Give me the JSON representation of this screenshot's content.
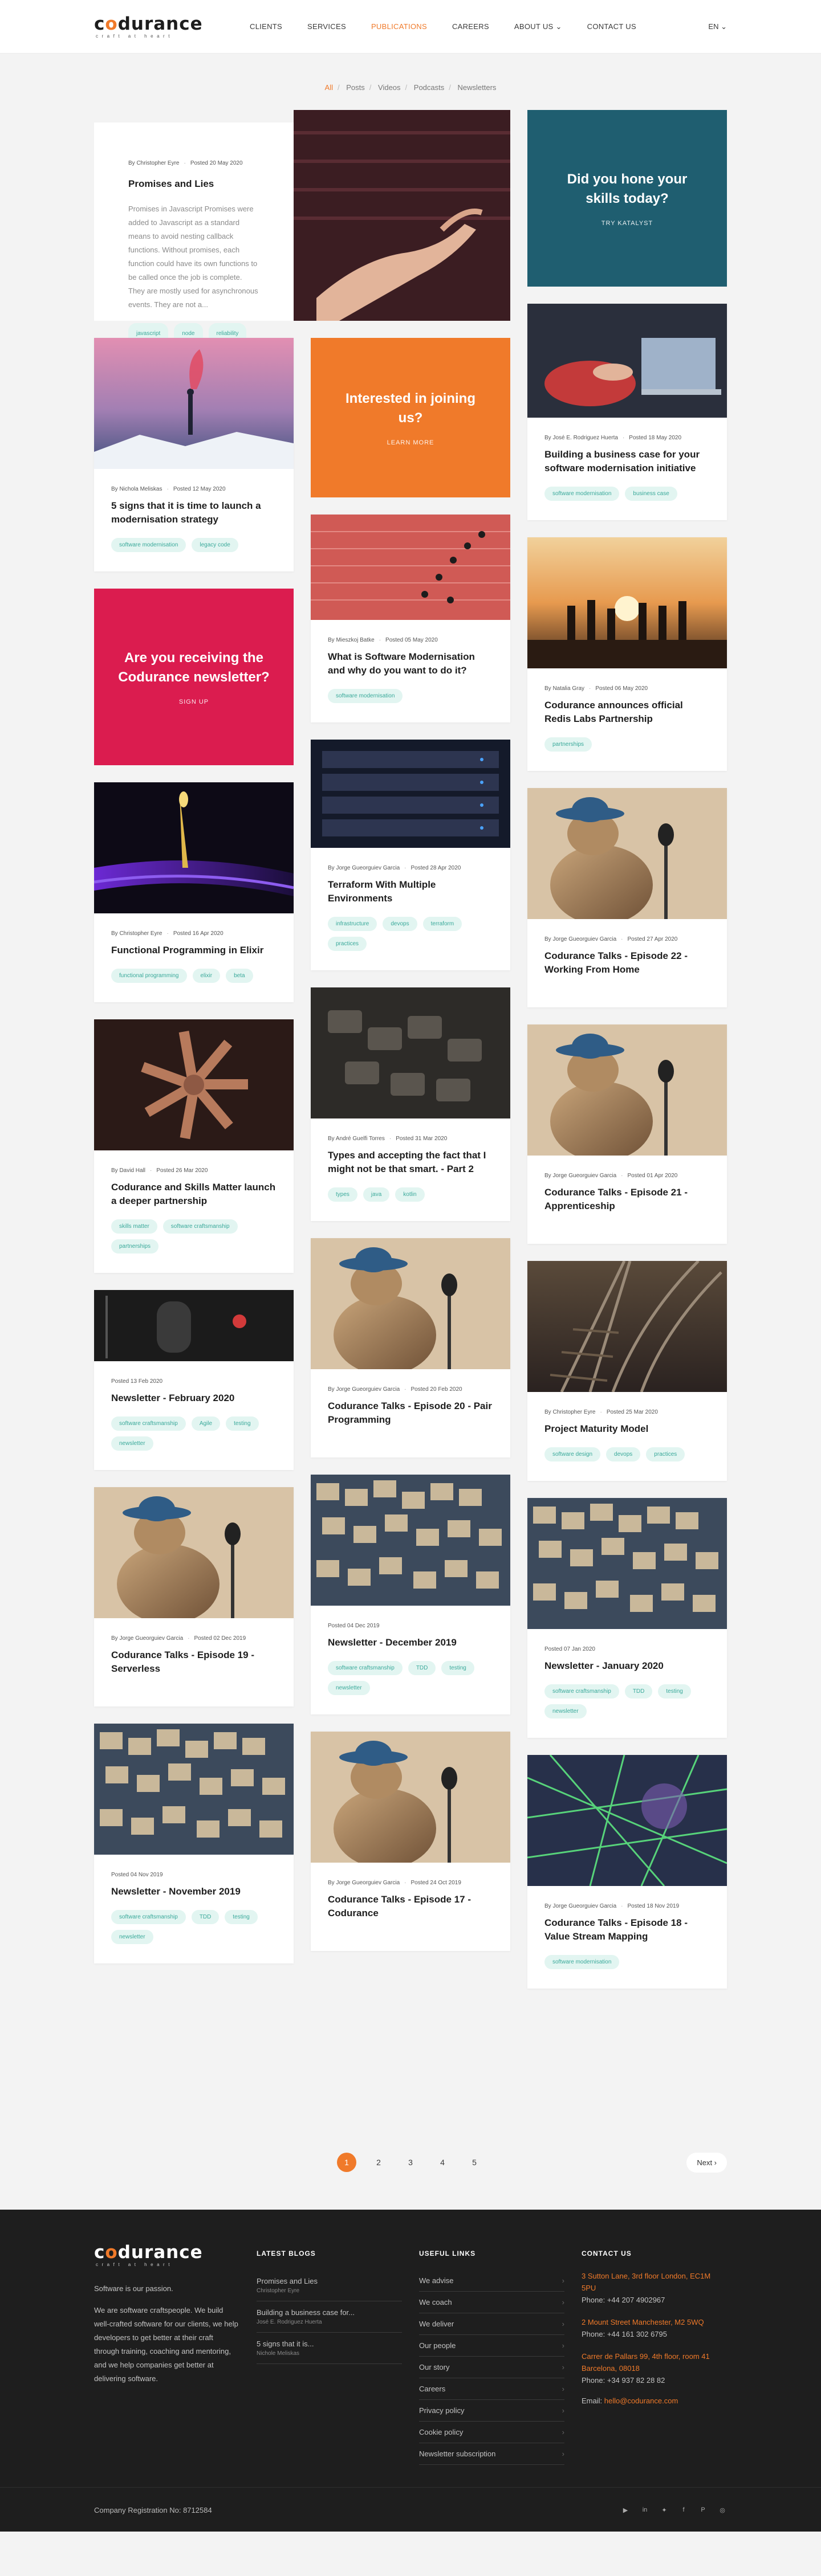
{
  "header": {
    "logo_main": "codurance",
    "logo_tag": "craft at heart",
    "nav": [
      "CLIENTS",
      "SERVICES",
      "PUBLICATIONS",
      "CAREERS",
      "ABOUT US",
      "CONTACT US"
    ],
    "nav_active": "PUBLICATIONS",
    "about_chevron": "⌄",
    "lang": "EN ⌄"
  },
  "filters": [
    "All",
    "Posts",
    "Videos",
    "Podcasts",
    "Newsletters"
  ],
  "filter_active": "All",
  "feature": {
    "author": "By Christopher Eyre",
    "date": "Posted 20 May 2020",
    "title": "Promises and Lies",
    "excerpt": "Promises in Javascript Promises were added to Javascript as a standard means to avoid nesting callback functions. Without promises, each function could have its own functions to be called once the job is complete. They are mostly used for asynchronous events. They are not a...",
    "tags": [
      "javascript",
      "node",
      "reliability"
    ]
  },
  "promos": {
    "teal": {
      "title": "Did you hone your skills today?",
      "link": "TRY KATALYST"
    },
    "orange": {
      "title": "Interested in joining us?",
      "link": "LEARN MORE"
    },
    "pink": {
      "title": "Are you receiving the Codurance newsletter?",
      "link": "SIGN UP"
    }
  },
  "cards": {
    "c1": {
      "author": "By Nichola Meliskas",
      "date": "Posted 12 May 2020",
      "title": "5 signs that it is time to launch a modernisation strategy",
      "tags": [
        "software modernisation",
        "legacy code"
      ]
    },
    "c2": {
      "author": "By Christopher Eyre",
      "date": "Posted 16 Apr 2020",
      "title": "Functional Programming in Elixir",
      "tags": [
        "functional programming",
        "elixir",
        "beta"
      ]
    },
    "c3": {
      "author": "By David Hall",
      "date": "Posted 26 Mar 2020",
      "title": "Codurance and Skills Matter launch a deeper partnership",
      "tags": [
        "skills matter",
        "software craftsmanship",
        "partnerships"
      ]
    },
    "c4": {
      "author": "",
      "date": "Posted 13 Feb 2020",
      "title": "Newsletter - February 2020",
      "tags": [
        "software craftsmanship",
        "Agile",
        "testing",
        "newsletter"
      ]
    },
    "c5": {
      "author": "By Jorge Gueorguiev Garcia",
      "date": "Posted 02 Dec 2019",
      "title": "Codurance Talks - Episode 19 - Serverless",
      "tags": []
    },
    "c6": {
      "author": "",
      "date": "Posted 04 Nov 2019",
      "title": "Newsletter - November 2019",
      "tags": [
        "software craftsmanship",
        "TDD",
        "testing",
        "newsletter"
      ]
    },
    "c7": {
      "author": "By Mieszkoj Batke",
      "date": "Posted 05 May 2020",
      "title": "What is Software Modernisation and why do you want to do it?",
      "tags": [
        "software modernisation"
      ]
    },
    "c8": {
      "author": "By Jorge Gueorguiev Garcia",
      "date": "Posted 28 Apr 2020",
      "title": "Terraform With Multiple Environments",
      "tags": [
        "infrastructure",
        "devops",
        "terraform",
        "practices"
      ]
    },
    "c9": {
      "author": "By André Guelfi Torres",
      "date": "Posted 31 Mar 2020",
      "title": "Types and accepting the fact that I might not be that smart. - Part 2",
      "tags": [
        "types",
        "java",
        "kotlin"
      ]
    },
    "c10": {
      "author": "By Jorge Gueorguiev Garcia",
      "date": "Posted 20 Feb 2020",
      "title": "Codurance Talks - Episode 20 - Pair Programming",
      "tags": []
    },
    "c11": {
      "author": "",
      "date": "Posted 04 Dec 2019",
      "title": "Newsletter - December 2019",
      "tags": [
        "software craftsmanship",
        "TDD",
        "testing",
        "newsletter"
      ]
    },
    "c12": {
      "author": "By Jorge Gueorguiev Garcia",
      "date": "Posted 24 Oct 2019",
      "title": "Codurance Talks - Episode 17 - Codurance",
      "tags": []
    },
    "c13": {
      "author": "By José E. Rodriguez Huerta",
      "date": "Posted 18 May 2020",
      "title": "Building a business case for your software modernisation initiative",
      "tags": [
        "software modernisation",
        "business case"
      ]
    },
    "c14": {
      "author": "By Natalia Gray",
      "date": "Posted 06 May 2020",
      "title": "Codurance announces official Redis Labs Partnership",
      "tags": [
        "partnerships"
      ]
    },
    "c15": {
      "author": "By Jorge Gueorguiev Garcia",
      "date": "Posted 27 Apr 2020",
      "title": "Codurance Talks - Episode 22 - Working From Home",
      "tags": []
    },
    "c16": {
      "author": "By Jorge Gueorguiev Garcia",
      "date": "Posted 01 Apr 2020",
      "title": "Codurance Talks - Episode 21 - Apprenticeship",
      "tags": []
    },
    "c17": {
      "author": "By Christopher Eyre",
      "date": "Posted 25 Mar 2020",
      "title": "Project Maturity Model",
      "tags": [
        "software design",
        "devops",
        "practices"
      ]
    },
    "c18": {
      "author": "",
      "date": "Posted 07 Jan 2020",
      "title": "Newsletter - January 2020",
      "tags": [
        "software craftsmanship",
        "TDD",
        "testing",
        "newsletter"
      ]
    },
    "c19": {
      "author": "By Jorge Gueorguiev Garcia",
      "date": "Posted 18 Nov 2019",
      "title": "Codurance Talks - Episode 18 - Value Stream Mapping",
      "tags": [
        "software modernisation"
      ]
    }
  },
  "pagination": {
    "pages": [
      "1",
      "2",
      "3",
      "4",
      "5"
    ],
    "active": "1",
    "next": "Next ›"
  },
  "footer": {
    "tagline": "Software is our passion.",
    "about": "We are software craftspeople. We build well-crafted software for our clients, we help developers to get better at their craft through training, coaching and mentoring, and we help companies get better at delivering software.",
    "latest_heading": "LATEST BLOGS",
    "latest": [
      {
        "title": "Promises and Lies",
        "author": "Christopher Eyre"
      },
      {
        "title": "Building a business case for...",
        "author": "José E. Rodriguez Huerta"
      },
      {
        "title": "5 signs that it is...",
        "author": "Nichole Meliskas"
      }
    ],
    "links_heading": "USEFUL LINKS",
    "links": [
      "We advise",
      "We coach",
      "We deliver",
      "Our people",
      "Our story",
      "Careers",
      "Privacy policy",
      "Cookie policy",
      "Newsletter subscription"
    ],
    "link_chevron": "›",
    "contact_heading": "CONTACT US",
    "offices": [
      {
        "address": "3 Sutton Lane, 3rd floor London, EC1M 5PU",
        "phone": "Phone: +44 207 4902967"
      },
      {
        "address": "2 Mount Street Manchester, M2 5WQ",
        "phone": "Phone: +44 161 302 6795"
      },
      {
        "address": "Carrer de Pallars 99, 4th floor, room 41 Barcelona, 08018",
        "phone": "Phone: +34 937 82 28 82"
      }
    ],
    "email_label": "Email:",
    "email": "hello@codurance.com",
    "registration": "Company Registration No: 8712584",
    "socials": [
      "youtube-icon",
      "linkedin-icon",
      "twitter-icon",
      "facebook-icon",
      "pinterest-icon",
      "instagram-icon"
    ]
  },
  "colors": {
    "accent": "#f07a2a",
    "teal": "#1f5e70",
    "pink": "#db1c4f",
    "tag": "#3aa99a"
  }
}
